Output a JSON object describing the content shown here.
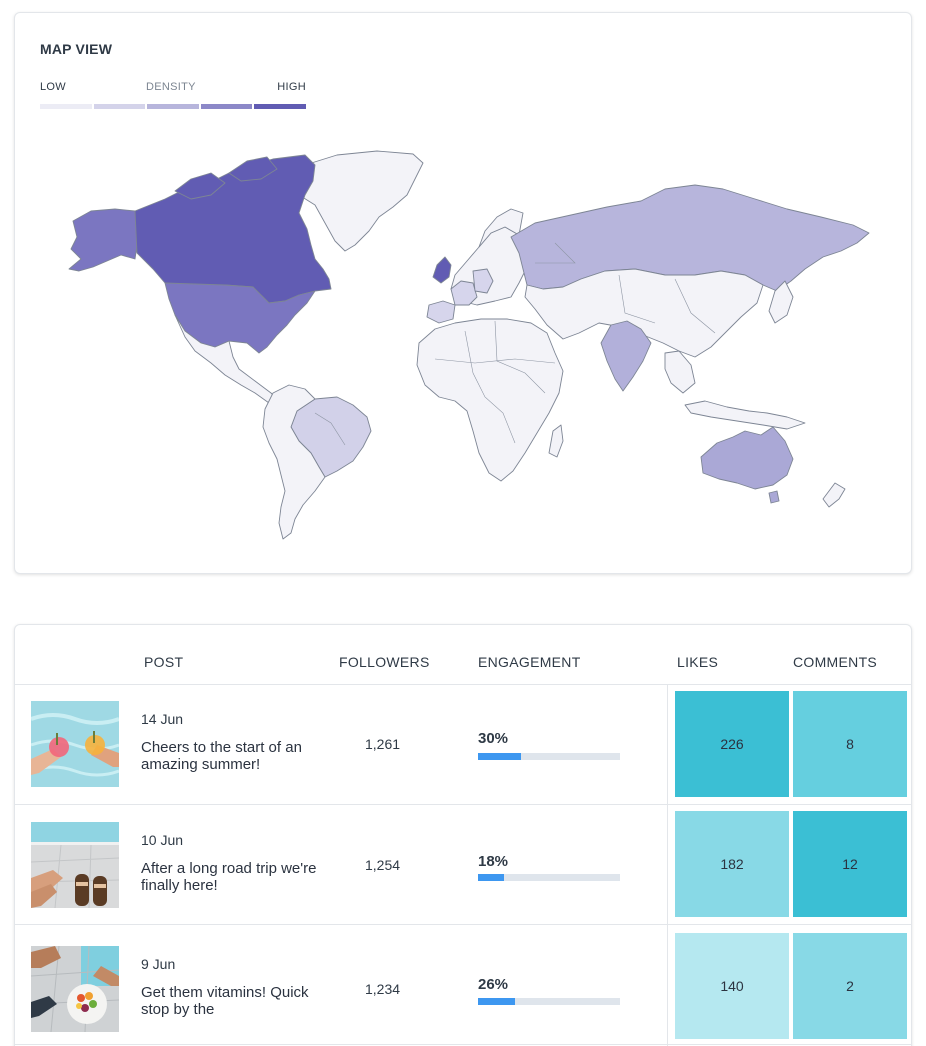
{
  "map": {
    "title": "MAP VIEW",
    "legend": {
      "low_label": "LOW",
      "mid_label": "DENSITY",
      "high_label": "HIGH",
      "colors": [
        "#ececf5",
        "#d4d3ea",
        "#b7b5dc",
        "#8c88c8",
        "#615cb3"
      ]
    },
    "density_levels": {
      "canada": "#615cb3",
      "alaska": "#7b76c1",
      "usa": "#7b76c1",
      "greenland": "#f3f3f8",
      "brazil": "#d2d1e9",
      "russia": "#b7b5dc",
      "india": "#b2b0da",
      "australia": "#aaa8d6",
      "uk": "#615cb3",
      "france": "#d6d5ec",
      "spain": "#d6d5ec",
      "germany": "#d6d5ec",
      "other": "#f3f3f8"
    }
  },
  "table": {
    "headers": {
      "post": "POST",
      "followers": "FOLLOWERS",
      "engagement": "ENGAGEMENT",
      "likes": "LIKES",
      "comments": "COMMENTS"
    },
    "rows": [
      {
        "date": "14 Jun",
        "caption": "Cheers to the start of an amazing summer!",
        "followers": "1,261",
        "engagement_label": "30%",
        "engagement": 0.3,
        "likes": "226",
        "likes_color": "#3bbfd4",
        "comments": "8",
        "comments_color": "#65cfdf",
        "thumb": "pool-drinks"
      },
      {
        "date": "10 Jun",
        "caption": "After a long road trip we're finally here!",
        "followers": "1,254",
        "engagement_label": "18%",
        "engagement": 0.18,
        "likes": "182",
        "likes_color": "#88d9e6",
        "comments": "12",
        "comments_color": "#3bbfd4",
        "thumb": "poolside-sandals"
      },
      {
        "date": "9 Jun",
        "caption": "Get them vitamins! Quick stop by the",
        "followers": "1,234",
        "engagement_label": "26%",
        "engagement": 0.26,
        "likes": "140",
        "likes_color": "#b5e8f0",
        "comments": "2",
        "comments_color": "#88d9e6",
        "thumb": "fruit-plate"
      }
    ]
  }
}
